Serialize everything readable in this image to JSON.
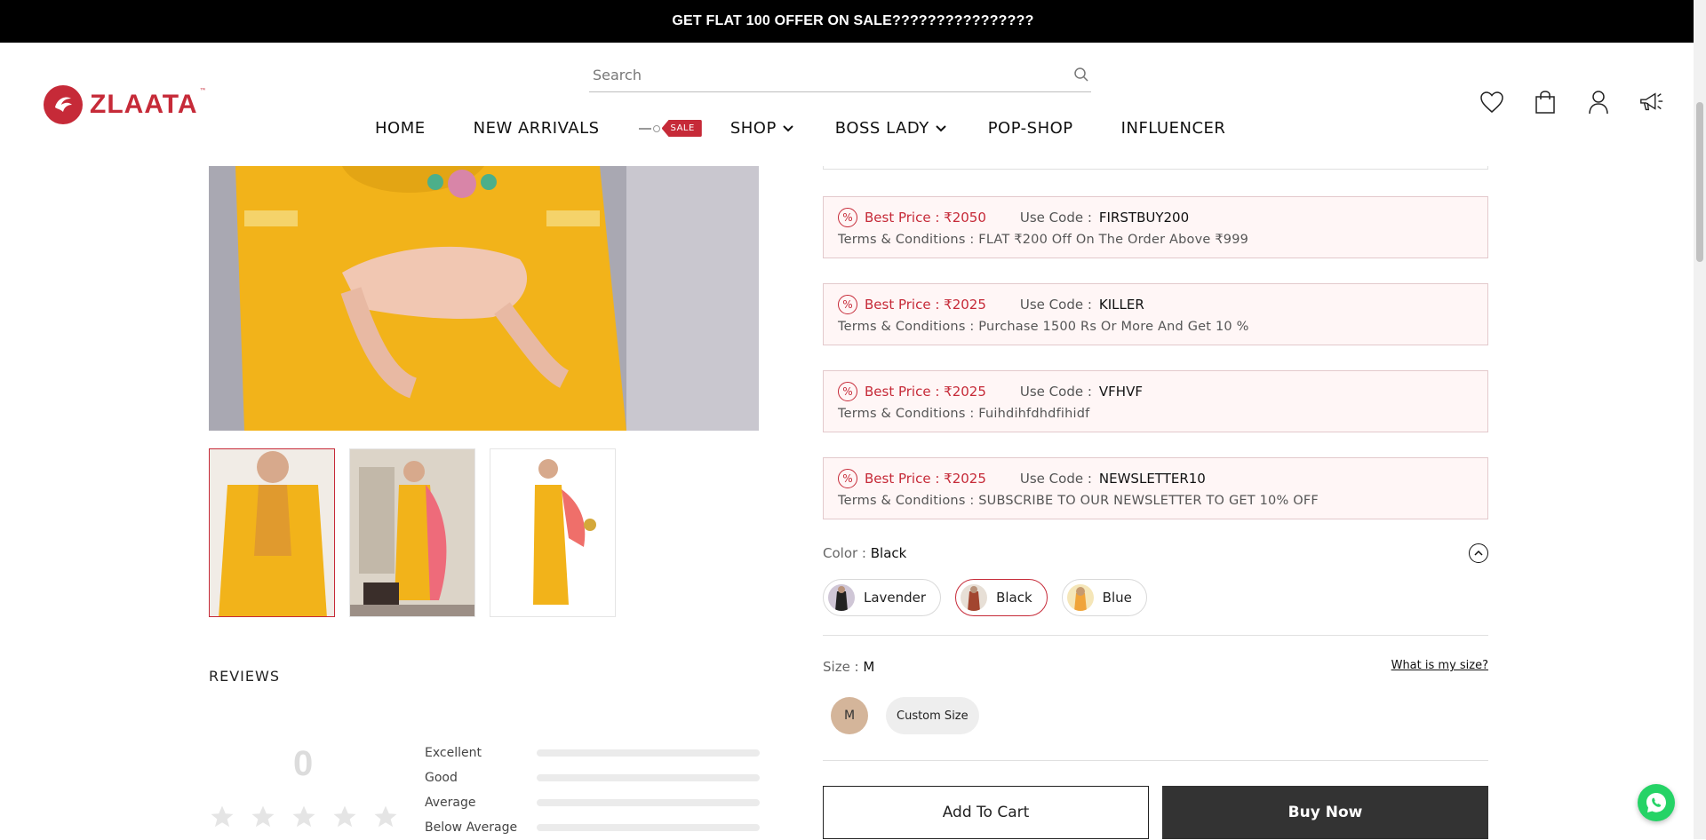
{
  "announcement": {
    "text": "GET FLAT 100 OFFER ON SALE????????????????"
  },
  "brand": {
    "name": "ZLAATA",
    "tm": "™",
    "color": "#c62a38"
  },
  "search": {
    "placeholder": "Search"
  },
  "nav": {
    "items": [
      {
        "label": "HOME"
      },
      {
        "label": "NEW ARRIVALS"
      },
      {
        "label": "SHOP",
        "has_dropdown": true
      },
      {
        "label": "BOSS LADY",
        "has_dropdown": true
      },
      {
        "label": "POP-SHOP"
      },
      {
        "label": "INFLUENCER"
      }
    ],
    "sale_tag": "SALE"
  },
  "header_icons": [
    "heart-icon",
    "shopping-bag-icon",
    "user-icon",
    "megaphone-icon"
  ],
  "offers": [
    {
      "best_price_label": "Best Price : ₹2050",
      "use_code_label": "Use Code :",
      "code": "FIRSTBUY200",
      "terms_label": "Terms & Conditions :",
      "terms": "FLAT ₹200 Off On The Order Above ₹999"
    },
    {
      "best_price_label": "Best Price : ₹2025",
      "use_code_label": "Use Code :",
      "code": "KILLER",
      "terms_label": "Terms & Conditions :",
      "terms": "Purchase 1500 Rs Or More And Get 10 %"
    },
    {
      "best_price_label": "Best Price : ₹2025",
      "use_code_label": "Use Code :",
      "code": "VFHVF",
      "terms_label": "Terms & Conditions :",
      "terms": "Fuihdihfdhdfihidf"
    },
    {
      "best_price_label": "Best Price : ₹2025",
      "use_code_label": "Use Code :",
      "code": "NEWSLETTER10",
      "terms_label": "Terms & Conditions :",
      "terms": "SUBSCRIBE TO OUR NEWSLETTER TO GET 10% OFF"
    }
  ],
  "color": {
    "label": "Color :",
    "selected": "Black",
    "options": [
      {
        "label": "Lavender"
      },
      {
        "label": "Black"
      },
      {
        "label": "Blue"
      }
    ]
  },
  "size": {
    "label": "Size :",
    "selected": "M",
    "help_link": "What is my size?",
    "options": [
      {
        "label": "M"
      },
      {
        "label": "Custom Size"
      }
    ]
  },
  "actions": {
    "add_to_cart": "Add To Cart",
    "buy_now": "Buy Now"
  },
  "reviews": {
    "title": "REVIEWS",
    "average": "0",
    "star_count": 5,
    "breakdown": [
      {
        "label": "Excellent",
        "fraction": 0
      },
      {
        "label": "Good",
        "fraction": 0
      },
      {
        "label": "Average",
        "fraction": 0
      },
      {
        "label": "Below Average",
        "fraction": 0
      }
    ]
  },
  "colors": {
    "accent": "#c62a38",
    "dark_button": "#333333",
    "offer_bg": "#fff6f6",
    "whatsapp": "#25d366",
    "product_yellow": "#f2b31a"
  }
}
